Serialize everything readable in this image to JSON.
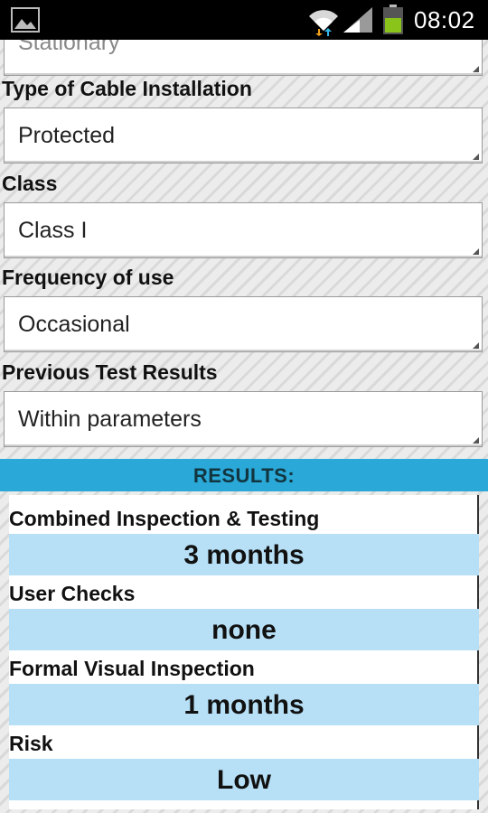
{
  "status_bar": {
    "time": "08:02",
    "icons": [
      "image-thumbnail-icon",
      "wifi-icon",
      "signal-icon",
      "battery-icon"
    ],
    "battery_color": "#8ac41a"
  },
  "form": {
    "partial_field_value": "Stationary",
    "fields": [
      {
        "label": "Type of Cable Installation",
        "value": "Protected"
      },
      {
        "label": "Class",
        "value": "Class I"
      },
      {
        "label": "Frequency of use",
        "value": "Occasional"
      },
      {
        "label": "Previous Test Results",
        "value": "Within parameters"
      }
    ]
  },
  "results": {
    "header": "RESULTS:",
    "header_color": "#2aa8d8",
    "value_bg_color": "#b7e0f6",
    "items": [
      {
        "label": "Combined Inspection & Testing",
        "value": "3 months"
      },
      {
        "label": "User Checks",
        "value": "none"
      },
      {
        "label": "Formal Visual Inspection",
        "value": "1 months"
      },
      {
        "label": "Risk",
        "value": "Low"
      }
    ]
  }
}
